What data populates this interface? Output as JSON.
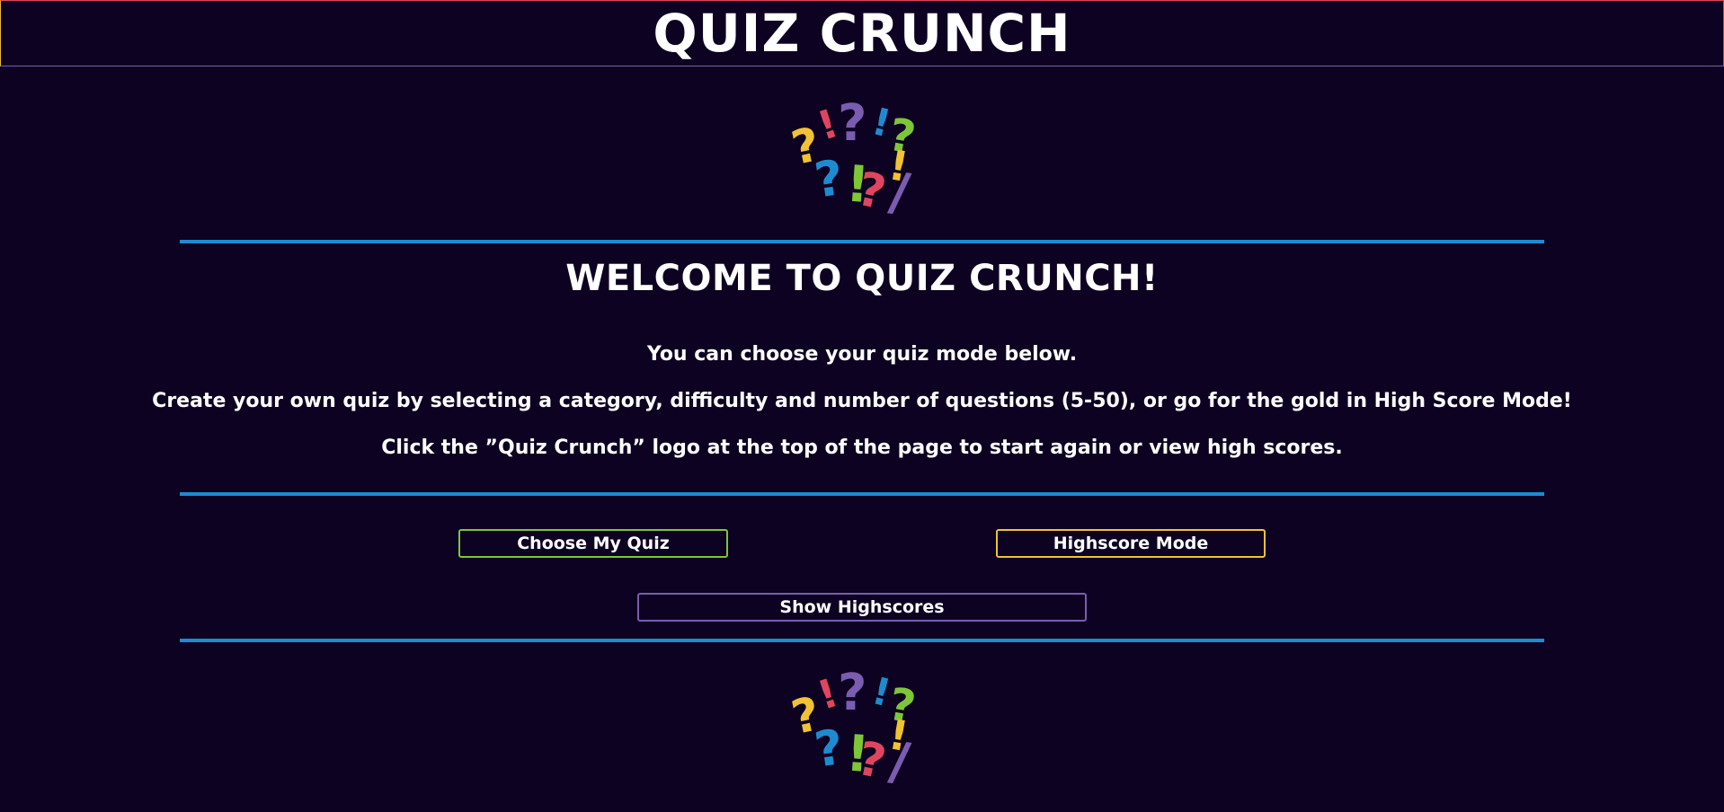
{
  "header": {
    "title": "QUIZ CRUNCH"
  },
  "logo": {
    "icon": "question-exclamation-logo",
    "glyphs": [
      {
        "char": "?",
        "color": "#f1c232"
      },
      {
        "char": "!",
        "color": "#e0455f"
      },
      {
        "char": "?",
        "color": "#7a5cb0"
      },
      {
        "char": "!",
        "color": "#1e8bd1"
      },
      {
        "char": "?",
        "color": "#7ec636"
      },
      {
        "char": "?",
        "color": "#1e8bd1"
      },
      {
        "char": "!",
        "color": "#7ec636"
      },
      {
        "char": "?",
        "color": "#e0455f"
      },
      {
        "char": "!",
        "color": "#f1c232"
      },
      {
        "char": "/",
        "color": "#7a5cb0"
      }
    ]
  },
  "main": {
    "heading": "WELCOME TO QUIZ CRUNCH!",
    "intro": [
      "You can choose your quiz mode below.",
      "Create your own quiz by selecting a category, difficulty and number of questions (5-50), or go for the gold in High Score Mode!",
      "Click the ”Quiz Crunch” logo at the top of the page to start again or view high scores."
    ]
  },
  "buttons": {
    "choose_quiz": "Choose My Quiz",
    "highscore_mode": "Highscore Mode",
    "show_highscores": "Show Highscores"
  },
  "colors": {
    "background": "#0d0221",
    "rule": "#1e8bd1",
    "green": "#7ec636",
    "yellow": "#f1c232",
    "purple": "#7a5cb0",
    "red": "#e0455f",
    "blue": "#1e8bd1"
  }
}
